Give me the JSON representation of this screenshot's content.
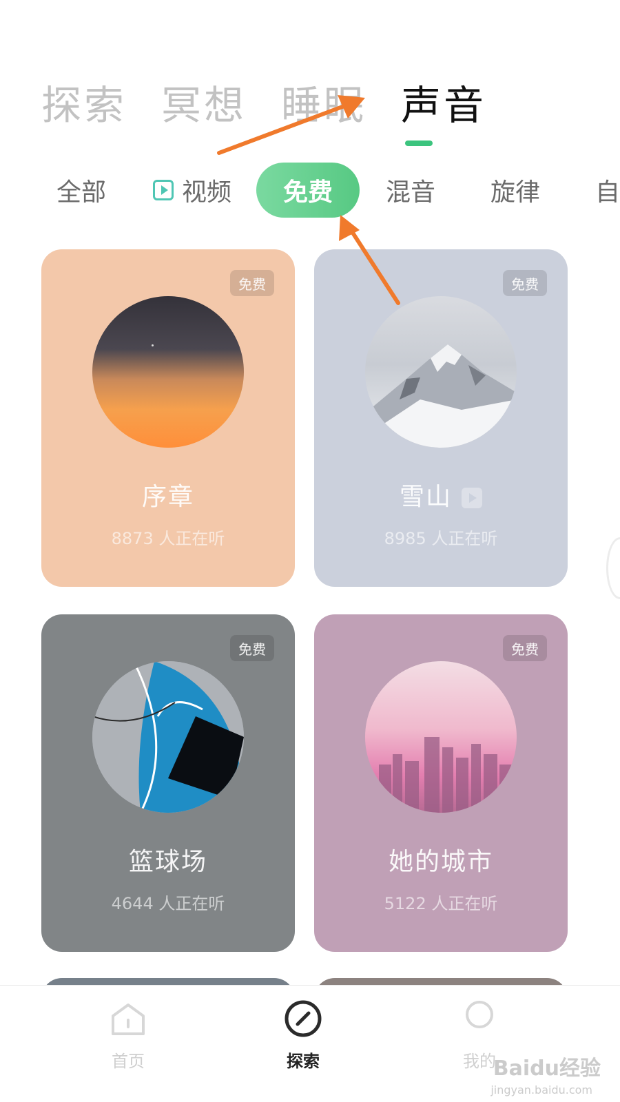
{
  "main_tabs": [
    {
      "label": "探索",
      "active": false
    },
    {
      "label": "冥想",
      "active": false
    },
    {
      "label": "睡眠",
      "active": false
    },
    {
      "label": "声音",
      "active": true
    }
  ],
  "filters": [
    {
      "label": "全部",
      "icon": null,
      "selected": false
    },
    {
      "label": "视频",
      "icon": "video-play-icon",
      "selected": false
    },
    {
      "label": "免费",
      "icon": null,
      "selected": true
    },
    {
      "label": "混音",
      "icon": null,
      "selected": false
    },
    {
      "label": "旋律",
      "icon": null,
      "selected": false
    },
    {
      "label": "自",
      "icon": null,
      "selected": false
    }
  ],
  "cards": [
    {
      "badge": "免费",
      "title": "序章",
      "count": "8873 人正在听",
      "has_video": false,
      "bg_color": "#f3c8aa",
      "cover": "dusk-gradient"
    },
    {
      "badge": "免费",
      "title": "雪山",
      "count": "8985 人正在听",
      "has_video": true,
      "bg_color": "#cbd0dc",
      "cover": "snow-mountain"
    },
    {
      "badge": "免费",
      "title": "篮球场",
      "count": "4644 人正在听",
      "has_video": false,
      "bg_color": "#818587",
      "cover": "basketball-court"
    },
    {
      "badge": "免费",
      "title": "她的城市",
      "count": "5122 人正在听",
      "has_video": false,
      "bg_color": "#c0a0b6",
      "cover": "pink-city"
    }
  ],
  "bottom_nav": [
    {
      "label": "首页",
      "icon": "home-icon",
      "active": false
    },
    {
      "label": "探索",
      "icon": "compass-icon",
      "active": true
    },
    {
      "label": "我的",
      "icon": "profile-icon",
      "active": false
    }
  ],
  "colors": {
    "accent": "#3cc47e",
    "annotation_arrow": "#f07a2c"
  },
  "watermark": {
    "text": "Baidu经验",
    "sub": "jingyan.baidu.com"
  }
}
